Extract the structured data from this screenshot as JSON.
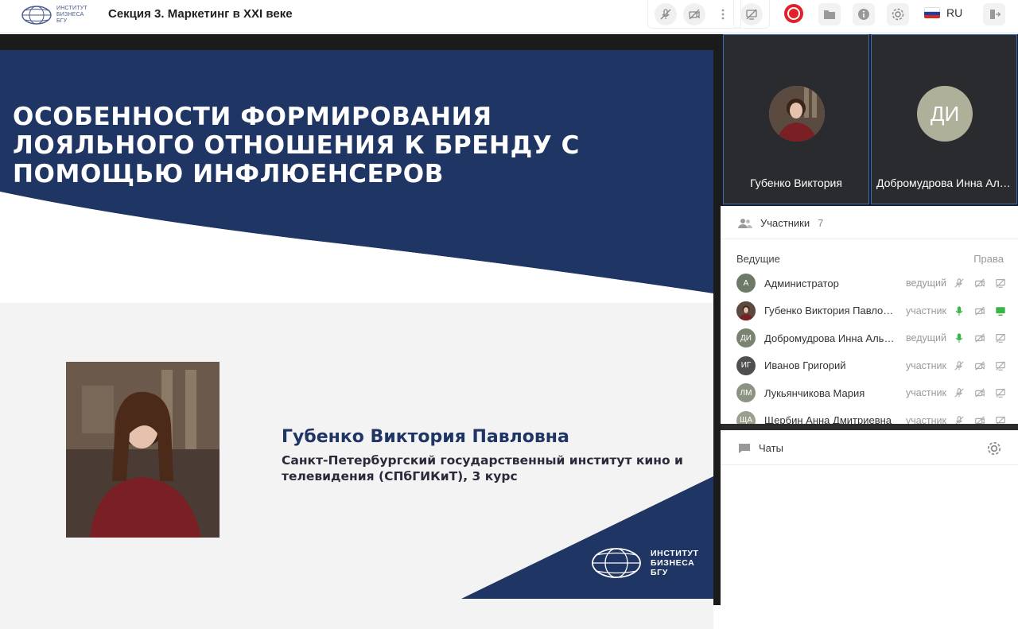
{
  "header": {
    "logo_text_1": "ИНСТИТУТ",
    "logo_text_2": "БИЗНЕСА",
    "logo_text_3": "БГУ",
    "title": "Секция 3. Маркетинг в XXI веке",
    "language": "RU"
  },
  "slide": {
    "title": "ОСОБЕННОСТИ ФОРМИРОВАНИЯ ЛОЯЛЬНОГО ОТНОШЕНИЯ К БРЕНДУ С ПОМОЩЬЮ ИНФЛЮЕНСЕРОВ",
    "speaker_name": "Губенко Виктория Павловна",
    "speaker_org": "Санкт-Петербургский государственный институт кино и телевидения (СПбГИКиТ), 3 курс",
    "logo_line_1": "ИНСТИТУТ",
    "logo_line_2": "БИЗНЕСА",
    "logo_line_3": "БГУ",
    "accent_color": "#1f3563"
  },
  "videos": [
    {
      "name": "Губенко Виктория",
      "initials": ""
    },
    {
      "name": "Добромудрова Инна Альбертовна",
      "initials": "ДИ"
    }
  ],
  "participants": {
    "label": "Участники",
    "count": "7",
    "section_label": "Ведущие",
    "rights_label": "Права",
    "items": [
      {
        "initials": "А",
        "name": "Администратор",
        "role": "ведущий",
        "mic": "off",
        "cam": "off",
        "screen": "off"
      },
      {
        "initials": "",
        "name": "Губенко Виктория Павловна",
        "role": "участник",
        "mic": "on",
        "cam": "off",
        "screen": "on"
      },
      {
        "initials": "ДИ",
        "name": "Добромудрова Инна Альбертовна",
        "role": "ведущий",
        "mic": "on",
        "cam": "off",
        "screen": "off"
      },
      {
        "initials": "ИГ",
        "name": "Иванов Григорий",
        "role": "участник",
        "mic": "off",
        "cam": "off",
        "screen": "off"
      },
      {
        "initials": "ЛМ",
        "name": "Лукьянчикова Мария",
        "role": "участник",
        "mic": "off",
        "cam": "off",
        "screen": "off"
      },
      {
        "initials": "ЩА",
        "name": "Щербин Анна Дмитриевна",
        "role": "участник",
        "mic": "off",
        "cam": "off",
        "screen": "off"
      }
    ]
  },
  "chats": {
    "label": "Чаты"
  },
  "icons": [
    "mic-off-icon",
    "camera-off-icon",
    "more-icon",
    "screen-share-off-icon",
    "record-icon",
    "folder-icon",
    "info-icon",
    "gear-icon",
    "flag-ru-icon",
    "exit-icon",
    "participants-icon",
    "chat-icon"
  ]
}
